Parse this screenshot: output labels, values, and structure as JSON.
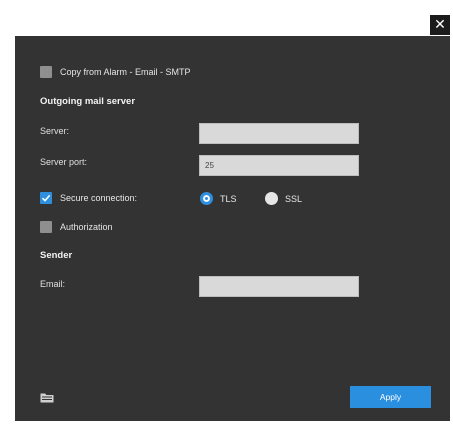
{
  "window": {
    "close_glyph": "✕"
  },
  "copy_option": {
    "label": "Copy from Alarm - Email - SMTP",
    "checked": false
  },
  "outgoing_mail_server": {
    "title": "Outgoing mail server",
    "server_label": "Server:",
    "server_value": "",
    "port_label": "Server port:",
    "port_value": "25",
    "secure_connection_label": "Secure connection:",
    "secure_connection_checked": true,
    "tls_label": "TLS",
    "ssl_label": "SSL",
    "selected_protocol": "TLS",
    "authorization_label": "Authorization",
    "authorization_checked": false
  },
  "sender": {
    "title": "Sender",
    "email_label": "Email:",
    "email_value": ""
  },
  "footer": {
    "apply_label": "Apply",
    "folder_icon": "folder-icon"
  },
  "colors": {
    "dialog_bg": "#333333",
    "accent": "#2b8fe0",
    "input_bg": "#d9d9d9"
  }
}
